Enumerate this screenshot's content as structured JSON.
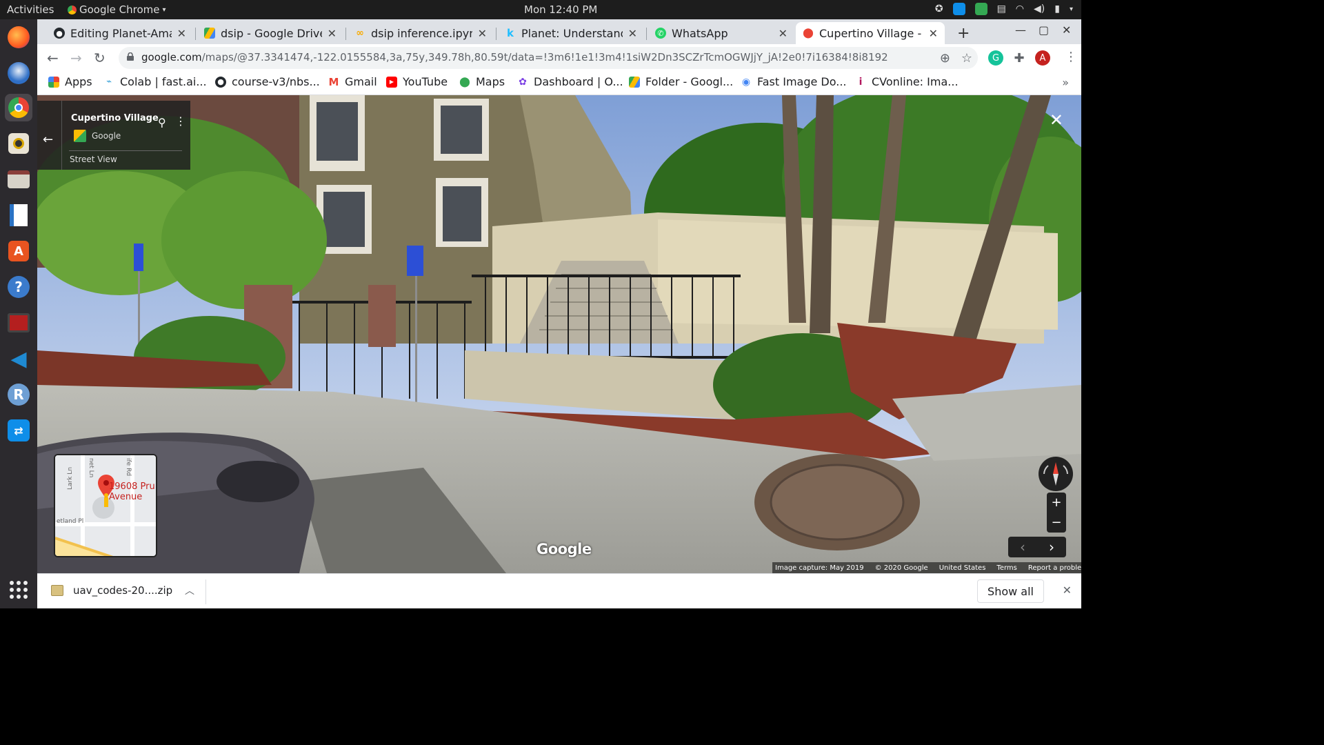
{
  "os_bar": {
    "activities": "Activities",
    "app_name": "Google Chrome",
    "clock": "Mon 12:40 PM"
  },
  "tabs": [
    {
      "title": "Editing Planet-Amaz",
      "icon": "github-icon"
    },
    {
      "title": "dsip - Google Drive",
      "icon": "google-drive-icon"
    },
    {
      "title": "dsip inference.ipynb",
      "icon": "colab-icon"
    },
    {
      "title": "Planet: Understandir",
      "icon": "kaggle-icon"
    },
    {
      "title": "WhatsApp",
      "icon": "whatsapp-icon"
    },
    {
      "title": "Cupertino Village - G",
      "icon": "google-maps-icon",
      "active": true
    }
  ],
  "toolbar": {
    "url_host": "google.com",
    "url_path": "/maps/@37.3341474,-122.0155584,3a,75y,349.78h,80.59t/data=!3m6!1e1!3m4!1siW2Dn3SCZrTcmOGWJjY_jA!2e0!7i16384!8i8192",
    "profile_initial": "A"
  },
  "bookmarks": [
    {
      "label": "Apps",
      "icon": "apps-grid-icon"
    },
    {
      "label": "Colab | fast.ai...",
      "icon": "colab-bookmark-icon"
    },
    {
      "label": "course-v3/nbs...",
      "icon": "github-bookmark-icon"
    },
    {
      "label": "Gmail",
      "icon": "gmail-icon"
    },
    {
      "label": "YouTube",
      "icon": "youtube-icon"
    },
    {
      "label": "Maps",
      "icon": "maps-bookmark-icon"
    },
    {
      "label": "Dashboard | O...",
      "icon": "dashboard-icon"
    },
    {
      "label": "Folder - Googl...",
      "icon": "drive-folder-icon"
    },
    {
      "label": "Fast Image Do...",
      "icon": "fast-image-icon"
    },
    {
      "label": "CVonline: Ima...",
      "icon": "cvonline-icon"
    }
  ],
  "street_view": {
    "place_name": "Cupertino Village",
    "provider": "Google",
    "mode_label": "Street View",
    "minimap_label_line1": "19608 Pru",
    "minimap_label_line2": "Avenue",
    "minimap_streets": [
      "Lark Ln",
      "ife Rd",
      "etland Pl",
      "net Ln"
    ],
    "watermark": "Google",
    "footer": [
      "Image capture: May 2019",
      "© 2020 Google",
      "United States",
      "Terms",
      "Report a problem"
    ]
  },
  "downloads": {
    "file_name": "uav_codes-20....zip",
    "show_all": "Show all"
  },
  "colors": {
    "chrome_tabstrip": "#dee1e6",
    "dock_bg": "#2c2a2e",
    "maps_red": "#ea4335"
  }
}
